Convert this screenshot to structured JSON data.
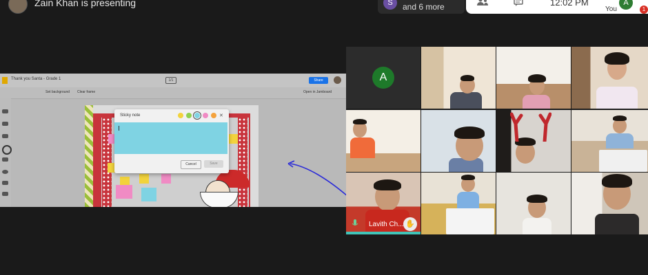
{
  "top_bar": {
    "presenting_text": "Zain Khan is presenting",
    "participants": {
      "avatar_letter": "S",
      "more_text": "and 6 more"
    },
    "clock": "12:02 PM",
    "you_label": "You",
    "self_avatar_letter": "A",
    "notification_count": "1",
    "icons": [
      "people-icon",
      "chat-icon"
    ]
  },
  "shared_screen": {
    "app_title": "Thank you Santa - Grade 1",
    "page_indicator": "1/1",
    "share_label": "Share",
    "toolbar": {
      "set_background": "Set background",
      "clear_frame": "Clear frame",
      "open_in_jamboard": "Open in Jamboard"
    },
    "sticky_note_dialog": {
      "title": "Sticky note",
      "colors": [
        "#f2d33c",
        "#8fd14f",
        "#7fd3e3",
        "#f08bc4",
        "#f4a23c"
      ],
      "cancel_label": "Cancel",
      "save_label": "Save",
      "text": ""
    }
  },
  "video_grid": {
    "tile_avatar_letter": "A",
    "speaker_name": "Lavith Ch..."
  },
  "colors": {
    "background": "#1a1a1a",
    "accent_teal": "#41c4b8",
    "avatar_green": "#1e7a2a"
  }
}
